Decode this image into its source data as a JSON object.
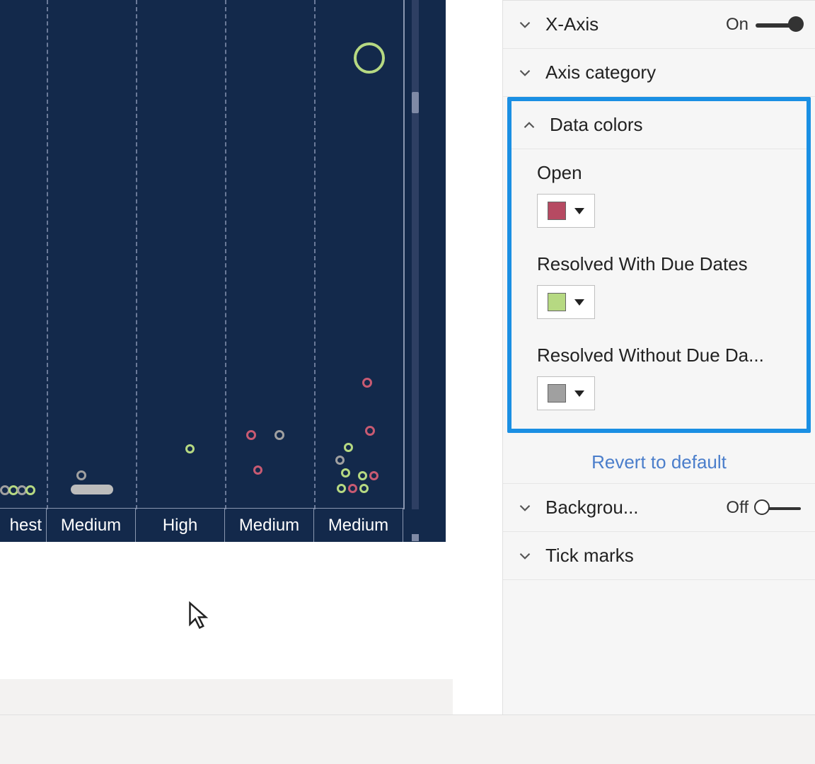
{
  "chart_data": {
    "type": "scatter",
    "categories": [
      "Highest",
      "Medium",
      "High",
      "Medium",
      "Medium"
    ],
    "series": [
      {
        "name": "Open",
        "color": "#c85a72"
      },
      {
        "name": "Resolved With Due Dates",
        "color": "#b6d982"
      },
      {
        "name": "Resolved Without Due Dates",
        "color": "#a0a0a0"
      }
    ],
    "xlabel": "",
    "ylabel": "",
    "note": "partial viewport of a larger scatter; y-axis not visible"
  },
  "axis": {
    "labels": [
      "hest",
      "Medium",
      "High",
      "Medium",
      "Medium"
    ]
  },
  "panel": {
    "xaxis": {
      "label": "X-Axis",
      "toggle_text": "On",
      "state": "on"
    },
    "axis_category": {
      "label": "Axis category"
    },
    "data_colors": {
      "label": "Data colors",
      "items": [
        {
          "label": "Open",
          "color": "#b64a62"
        },
        {
          "label": "Resolved With Due Dates",
          "color": "#b6d982"
        },
        {
          "label": "Resolved Without Due Da...",
          "color": "#a0a0a0"
        }
      ],
      "revert": "Revert to default"
    },
    "background": {
      "label": "Backgrou...",
      "toggle_text": "Off",
      "state": "off"
    },
    "tick_marks": {
      "label": "Tick marks"
    }
  }
}
